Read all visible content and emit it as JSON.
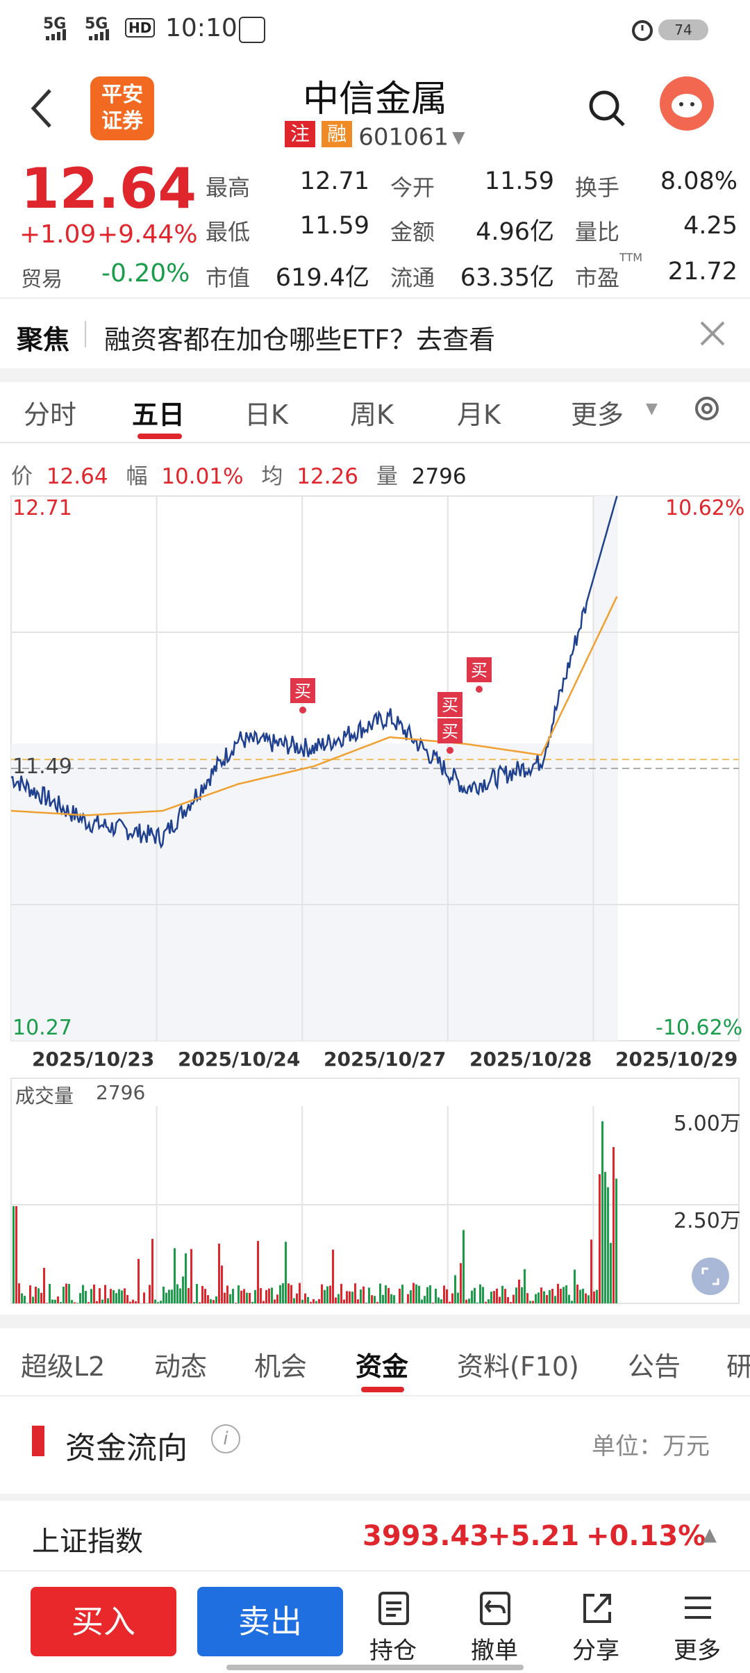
{
  "status": {
    "net1": "5G",
    "net2": "5G",
    "hd": "HD",
    "time": "10:10",
    "battery": "74"
  },
  "header": {
    "logo_line1": "平安",
    "logo_line2": "证券",
    "stock_name": "中信金属",
    "tag_reg": "注",
    "tag_margin": "融",
    "stock_code": "601061"
  },
  "quote": {
    "price": "12.64",
    "change": "+1.09",
    "change_pct": "+9.44%",
    "trade_label": "贸易",
    "trade_pct": "-0.20%",
    "fields": [
      {
        "label": "最高",
        "value": "12.71",
        "color": "red"
      },
      {
        "label": "今开",
        "value": "11.59",
        "color": "red"
      },
      {
        "label": "换手",
        "value": "8.08%",
        "color": "black"
      },
      {
        "label": "最低",
        "value": "11.59",
        "color": "red"
      },
      {
        "label": "金额",
        "value": "4.96亿",
        "color": "black"
      },
      {
        "label": "量比",
        "value": "4.25",
        "color": "black"
      },
      {
        "label": "市值",
        "value": "619.4亿",
        "color": "black"
      },
      {
        "label": "流通",
        "value": "63.35亿",
        "color": "black"
      },
      {
        "label": "市盈",
        "value": "21.72",
        "color": "black"
      }
    ],
    "ttm": "TTM"
  },
  "focus": {
    "label": "聚焦",
    "text": "融资客都在加仓哪些ETF？去查看"
  },
  "chart_tabs": [
    "分时",
    "五日",
    "日K",
    "周K",
    "月K",
    "更多"
  ],
  "chart_info": {
    "price_label": "价",
    "price": "12.64",
    "amp_label": "幅",
    "amp": "10.01%",
    "avg_label": "均",
    "avg": "12.26",
    "vol_label": "量",
    "vol": "2796"
  },
  "price_axis": {
    "top": "12.71",
    "mid": "11.49",
    "bottom": "10.27",
    "top_pct": "10.62%",
    "bottom_pct": "-10.62%"
  },
  "buy_marker": "买",
  "dates": [
    "2025/10/23",
    "2025/10/24",
    "2025/10/27",
    "2025/10/28",
    "2025/10/29"
  ],
  "volume_panel": {
    "label": "成交量",
    "value": "2796",
    "max_label": "5.00万",
    "mid_label": "2.50万"
  },
  "bottom_tabs": [
    "超级L2",
    "动态",
    "机会",
    "资金",
    "资料(F10)",
    "公告",
    "研"
  ],
  "fund_flow": {
    "title": "资金流向",
    "unit": "单位：万元"
  },
  "index_bar": {
    "name": "上证指数",
    "value": "3993.43",
    "change": "+5.21",
    "pct": "+0.13%"
  },
  "actions": {
    "buy": "买入",
    "sell": "卖出",
    "holdings": "持仓",
    "cancel": "撤单",
    "share": "分享",
    "more": "更多"
  },
  "chart_data": {
    "type": "line",
    "title": "",
    "x": [
      "2025/10/23",
      "2025/10/24",
      "2025/10/27",
      "2025/10/28",
      "2025/10/29"
    ],
    "ylim": [
      10.27,
      12.71
    ],
    "reference_price": 11.49,
    "series": [
      {
        "name": "价",
        "values": [
          11.45,
          11.2,
          11.6,
          11.55,
          12.64
        ]
      },
      {
        "name": "均",
        "values": [
          11.3,
          11.3,
          11.45,
          11.68,
          12.26
        ]
      }
    ],
    "volume_ylim": [
      0,
      50000
    ]
  }
}
